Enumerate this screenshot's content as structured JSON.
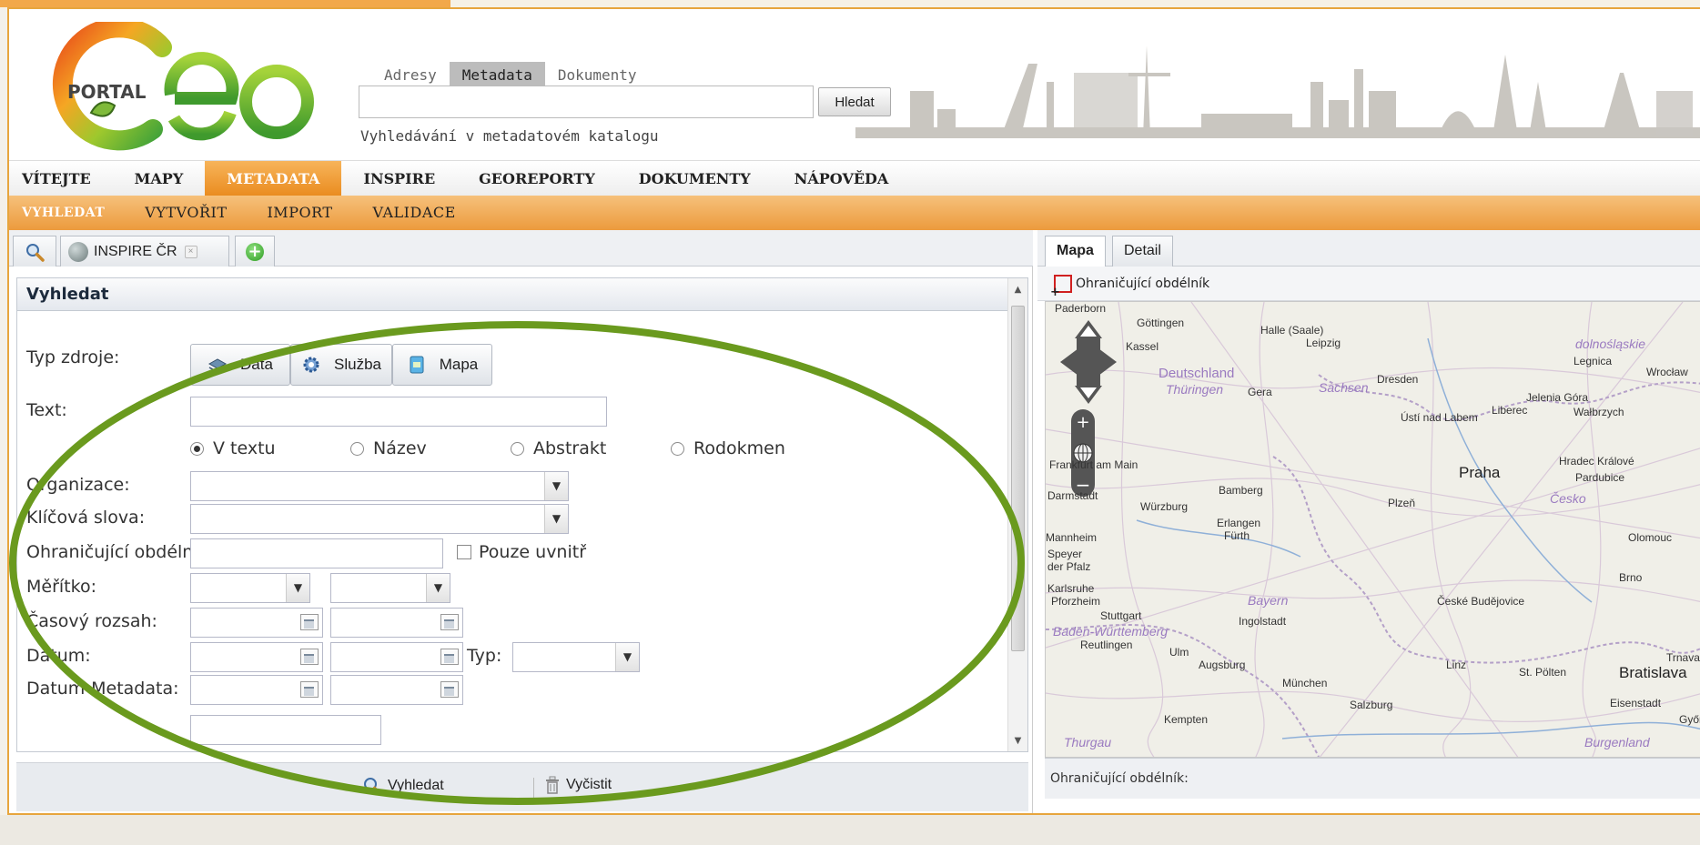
{
  "logo": {
    "text": "PORTAL"
  },
  "search": {
    "tabs": [
      "Adresy",
      "Metadata",
      "Dokumenty"
    ],
    "active_tab": 1,
    "input_value": "",
    "button_label": "Hledat",
    "hint": "Vyhledávání v metadatovém katalogu"
  },
  "main_nav": {
    "items": [
      "VÍTEJTE",
      "MAPY",
      "METADATA",
      "INSPIRE",
      "GEOREPORTY",
      "DOKUMENTY",
      "NÁPOVĚDA"
    ],
    "active": 2
  },
  "sub_nav": {
    "items": [
      "VYHLEDAT",
      "VYTVOŘIT",
      "IMPORT",
      "VALIDACE"
    ],
    "active": 0
  },
  "left_tabs": {
    "inspire_label": "INSPIRE ČR",
    "close_glyph": "×"
  },
  "form": {
    "title": "Vyhledat",
    "labels": {
      "resource_type": "Typ zdroje:",
      "text": "Text:",
      "organization": "Organizace:",
      "keywords": "Klíčová slova:",
      "bbox": "Ohraničující obdélník:",
      "scale": "Měřítko:",
      "time_range": "Časový rozsah:",
      "date": "Datum:",
      "date_metadata": "Datum-Metadata:",
      "date_type": "Typ:"
    },
    "type_buttons": [
      "Data",
      "Služba",
      "Mapa"
    ],
    "text_value": "",
    "radios": [
      "V textu",
      "Název",
      "Abstrakt",
      "Rodokmen"
    ],
    "radio_checked": 0,
    "checkbox_inside": "Pouze uvnitř",
    "dropdown_arrow": "▼",
    "footer": {
      "search": "Vyhledat",
      "clear": "Vyčistit"
    }
  },
  "map_panel": {
    "tabs": [
      "Mapa",
      "Detail"
    ],
    "active_tab": 0,
    "tool_label": "Ohraničující obdélník",
    "status_label": "Ohraničující obdélník:",
    "cities": [
      {
        "name": "Paderborn"
      },
      {
        "name": "Göttingen"
      },
      {
        "name": "Halle (Saale)"
      },
      {
        "name": "Leipzig"
      },
      {
        "name": "Kassel"
      },
      {
        "name": "Deutschland"
      },
      {
        "name": "Thüringen"
      },
      {
        "name": "Gera"
      },
      {
        "name": "Sachsen"
      },
      {
        "name": "Dresden"
      },
      {
        "name": "Legnica"
      },
      {
        "name": "Wrocław"
      },
      {
        "name": "Jelenia Góra"
      },
      {
        "name": "Wałbrzych"
      },
      {
        "name": "Liberec"
      },
      {
        "name": "Ústí nad Labem"
      },
      {
        "name": "Frankfurt am Main"
      },
      {
        "name": "Darmstadt"
      },
      {
        "name": "Bamberg"
      },
      {
        "name": "Würzburg"
      },
      {
        "name": "Praha"
      },
      {
        "name": "Hradec Králové"
      },
      {
        "name": "Pardubice"
      },
      {
        "name": "Česko"
      },
      {
        "name": "Plzeň"
      },
      {
        "name": "Erlangen"
      },
      {
        "name": "Fürth"
      },
      {
        "name": "Mannheim"
      },
      {
        "name": "Speyer"
      },
      {
        "name": "Olomouc"
      },
      {
        "name": "Brno"
      },
      {
        "name": "Karlsruhe"
      },
      {
        "name": "Pforzheim"
      },
      {
        "name": "Bayern"
      },
      {
        "name": "Stuttgart"
      },
      {
        "name": "Ingolstadt"
      },
      {
        "name": "České Budějovice"
      },
      {
        "name": "Baden-Württemberg"
      },
      {
        "name": "Reutlingen"
      },
      {
        "name": "Ulm"
      },
      {
        "name": "Augsburg"
      },
      {
        "name": "Linz"
      },
      {
        "name": "St. Pölten"
      },
      {
        "name": "Bratislava"
      },
      {
        "name": "Trnava"
      },
      {
        "name": "München"
      },
      {
        "name": "Salzburg"
      },
      {
        "name": "Eisenstadt"
      },
      {
        "name": "Kempten"
      },
      {
        "name": "Győr"
      },
      {
        "name": "Burgenland"
      },
      {
        "name": "Thurgau"
      },
      {
        "name": "dolnośląskie"
      },
      {
        "name": "der Pfalz"
      }
    ]
  },
  "colors": {
    "accent_orange": "#ec9b3d",
    "annotation_green": "#6a9a1e",
    "frame_orange": "#e7a53d"
  }
}
